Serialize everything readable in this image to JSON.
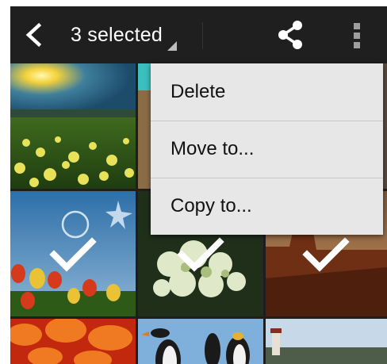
{
  "action_bar": {
    "title": "3 selected",
    "back_icon": "back-chevron-icon",
    "share_icon": "share-icon",
    "overflow_icon": "overflow-menu-icon"
  },
  "menu": {
    "items": [
      {
        "label": "Delete"
      },
      {
        "label": "Move to..."
      },
      {
        "label": "Copy to..."
      }
    ]
  },
  "grid": {
    "selected_count": 3,
    "photos": [
      {
        "subject": "sunset meadow with yellow flowers",
        "selected": false
      },
      {
        "subject": "partially hidden photo",
        "selected": false
      },
      {
        "subject": "hidden photo",
        "selected": false
      },
      {
        "subject": "tulips under blue sky",
        "selected": true
      },
      {
        "subject": "white hydrangea",
        "selected": true
      },
      {
        "subject": "desert canyon at dusk",
        "selected": true
      },
      {
        "subject": "orange flowers",
        "selected": false
      },
      {
        "subject": "penguins",
        "selected": false
      },
      {
        "subject": "lighthouse coast",
        "selected": false
      }
    ]
  },
  "colors": {
    "action_bar": "#1f1f1f",
    "menu_background": "#e7e7e7",
    "menu_text": "#111111",
    "checkmark": "#ffffff"
  }
}
